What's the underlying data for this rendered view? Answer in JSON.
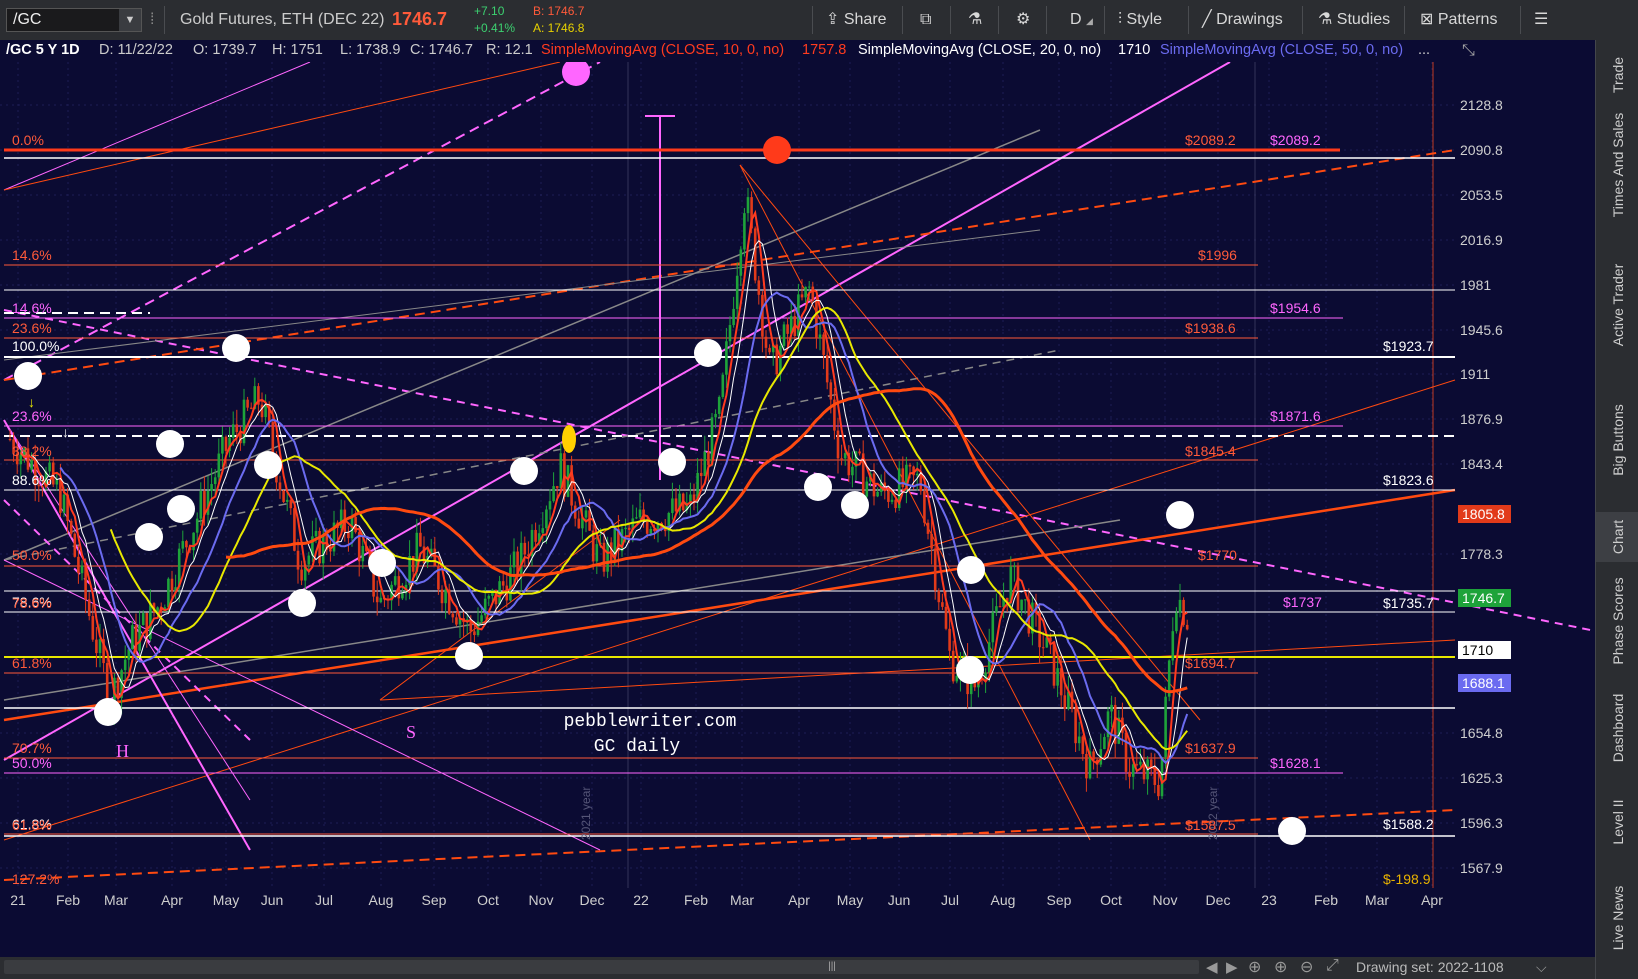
{
  "toolbar": {
    "symbol": "/GC",
    "instrument": "Gold Futures, ETH (DEC 22)",
    "last_price": "1746.7",
    "change": "+7.10",
    "change_pct": "+0.41%",
    "bid": "B: 1746.7",
    "ask": "A: 1746.8",
    "share": "Share",
    "interval": "D",
    "style": "Style",
    "drawings": "Drawings",
    "studies": "Studies",
    "patterns": "Patterns"
  },
  "info": {
    "title": "/GC 5 Y 1D",
    "date": "D: 11/22/22",
    "open": "O: 1739.7",
    "high": "H: 1751",
    "low": "L: 1738.9",
    "close": "C: 1746.7",
    "range": "R: 12.1",
    "sma10_label": "SimpleMovingAvg (CLOSE, 10, 0, no)",
    "sma10_value": "1757.8",
    "sma20_label": "SimpleMovingAvg (CLOSE, 20, 0, no)",
    "sma20_value": "1710",
    "sma50_label": "SimpleMovingAvg (CLOSE, 50, 0, no)",
    "more": "..."
  },
  "price_axis": {
    "ticks": [
      "2128.8",
      "2090.8",
      "2053.5",
      "2016.9",
      "1981",
      "1945.6",
      "1911",
      "1876.9",
      "1843.4",
      "1778.3",
      "1654.8",
      "1625.3",
      "1596.3",
      "1567.9"
    ],
    "badges": [
      {
        "text": "1805.8",
        "bg": "#e23a1a",
        "fg": "#ffffff"
      },
      {
        "text": "1746.7",
        "bg": "#1ea33a",
        "fg": "#ffffff"
      },
      {
        "text": "1710",
        "bg": "#ffffff",
        "fg": "#000000"
      },
      {
        "text": "1688.1",
        "bg": "#6b6bf0",
        "fg": "#ffffff"
      }
    ]
  },
  "time_axis": [
    "21",
    "Feb",
    "Mar",
    "Apr",
    "May",
    "Jun",
    "Jul",
    "Aug",
    "Sep",
    "Oct",
    "Nov",
    "Dec",
    "22",
    "Feb",
    "Mar",
    "Apr",
    "May",
    "Jun",
    "Jul",
    "Aug",
    "Sep",
    "Oct",
    "Nov",
    "Dec",
    "23",
    "Feb",
    "Mar",
    "Apr"
  ],
  "fib_labels_left": [
    {
      "text": "0.0%",
      "color": "#ff5a3a"
    },
    {
      "text": "14.6%",
      "color": "#ff5a3a"
    },
    {
      "text": "14.6%",
      "color": "#ff66ff"
    },
    {
      "text": "23.6%",
      "color": "#ff5a3a"
    },
    {
      "text": "100.0%",
      "color": "#ffffff"
    },
    {
      "text": "23.6%",
      "color": "#ff66ff"
    },
    {
      "text": "38.2%",
      "color": "#ff5a3a"
    },
    {
      "text": "88.6%",
      "color": "#ffffff"
    },
    {
      "text": "50.0%",
      "color": "#ff5a3a"
    },
    {
      "text": "78.6%",
      "color": "#ffffff"
    },
    {
      "text": "78.6%",
      "color": "#ff5a3a"
    },
    {
      "text": "61.8%",
      "color": "#ff5a3a"
    },
    {
      "text": "70.7%",
      "color": "#ff5a3a"
    },
    {
      "text": "50.0%",
      "color": "#ff66ff"
    },
    {
      "text": "61.8%",
      "color": "#ffffff"
    },
    {
      "text": "61.8%",
      "color": "#ff5a3a"
    },
    {
      "text": "127.2%",
      "color": "#ff5a3a"
    }
  ],
  "level_labels": [
    {
      "text": "$2089.2",
      "color": "#ff5a3a"
    },
    {
      "text": "$2089.2",
      "color": "#ff66ff"
    },
    {
      "text": "$1996",
      "color": "#ff5a3a"
    },
    {
      "text": "$1954.6",
      "color": "#ff66ff"
    },
    {
      "text": "$1938.6",
      "color": "#ff5a3a"
    },
    {
      "text": "$1923.7",
      "color": "#ffffff"
    },
    {
      "text": "$1871.6",
      "color": "#ff66ff"
    },
    {
      "text": "$1845.4",
      "color": "#ff5a3a"
    },
    {
      "text": "$1823.6",
      "color": "#ffffff"
    },
    {
      "text": "$1770",
      "color": "#ff5a3a"
    },
    {
      "text": "$1737",
      "color": "#ff66ff"
    },
    {
      "text": "$1735.7",
      "color": "#ffffff"
    },
    {
      "text": "$1694.7",
      "color": "#ff5a3a"
    },
    {
      "text": "$1637.9",
      "color": "#ff5a3a"
    },
    {
      "text": "$1628.1",
      "color": "#ff66ff"
    },
    {
      "text": "$1587.5",
      "color": "#ff5a3a"
    },
    {
      "text": "$1588.2",
      "color": "#ffffff"
    },
    {
      "text": "$-198.9",
      "color": "#e8b200"
    }
  ],
  "annotations": {
    "watermark_line1": "pebblewriter.com",
    "watermark_line2": "GC daily",
    "head_marker": "H",
    "shoulder_marker": "S",
    "year_2021": "2021 year",
    "year_2022": "2022 year"
  },
  "right_tabs": [
    "Trade",
    "Times And Sales",
    "Active Trader",
    "Big Buttons",
    "Chart",
    "Phase Scores",
    "Dashboard",
    "Level II",
    "Live News"
  ],
  "bottom": {
    "drawing_set": "Drawing set: 2022-1108"
  },
  "colors": {
    "background": "#0b0b33",
    "sma10": "#ff3b1f",
    "sma20": "#ffffff",
    "sma50": "#6b6bf0",
    "sma_yellow": "#e8e800",
    "sma_orange": "#ff4a10",
    "candle_up": "#1ea33a",
    "candle_down": "#e23a1a"
  }
}
